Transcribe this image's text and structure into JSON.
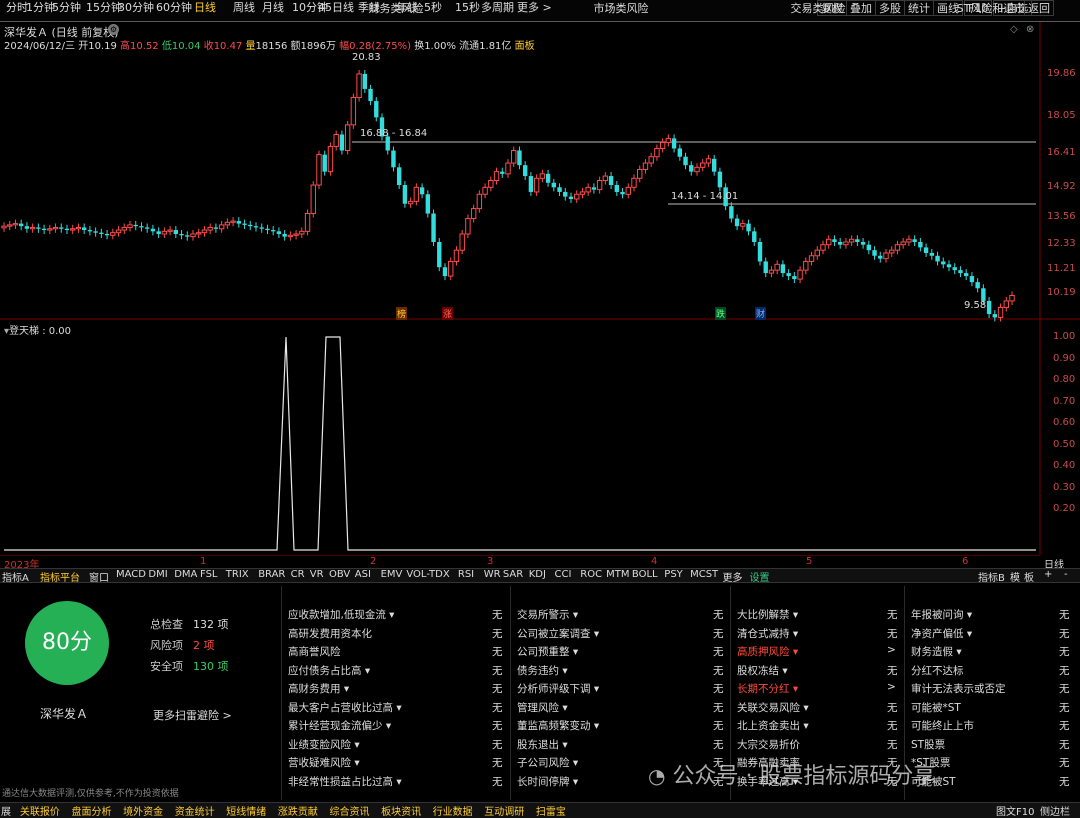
{
  "toolbar": {
    "periods": [
      "分时",
      "1分钟",
      "5分钟",
      "15分钟",
      "30分钟",
      "60分钟",
      "日线",
      "周线",
      "月线",
      "10分钟",
      "45日线",
      "季线",
      "年线",
      "5秒",
      "15秒",
      "多周期",
      "更多 >"
    ],
    "active_period": "日线",
    "right_buttons": [
      "复权",
      "叠加",
      "多股",
      "统计",
      "画线",
      "F10",
      "+自选",
      "返回"
    ]
  },
  "stock": {
    "title": "深华发Ａ (日线 前复权)",
    "date": "2024/06/12/三",
    "open_label": "开",
    "open": "10.19",
    "high_label": "高",
    "high": "10.52",
    "low_label": "低",
    "low": "10.04",
    "close_label": "收",
    "close": "10.47",
    "vol_label": "量",
    "vol": "18156",
    "amount_label": "额",
    "amount": "1896万",
    "change_label": "幅",
    "change": "0.28(2.75%)",
    "turnover_label": "换",
    "turnover": "1.00%",
    "float_label": "流通",
    "float": "1.81亿",
    "board": "面板"
  },
  "price_axis": [
    "19.86",
    "18.05",
    "16.41",
    "14.92",
    "13.56",
    "12.33",
    "11.21",
    "10.19"
  ],
  "annotations": {
    "peak": "20.83",
    "gap1": "16.88 - 16.84",
    "gap2": "14.14 - 14.01",
    "low": "9.58"
  },
  "event_badges": [
    "榜",
    "涨",
    "跌",
    "财"
  ],
  "indicator": {
    "title": "登天梯 : 0.00",
    "axis": [
      "1.00",
      "0.90",
      "0.80",
      "0.70",
      "0.60",
      "0.50",
      "0.40",
      "0.30",
      "0.20"
    ]
  },
  "x_axis": {
    "labels": [
      "2023年",
      "1",
      "2",
      "3",
      "4",
      "5",
      "6"
    ],
    "period": "日线"
  },
  "indicator_tabs": [
    "指标A",
    "指标平台",
    "窗口",
    "MACD",
    "DMI",
    "DMA",
    "FSL",
    "TRIX",
    "BRAR",
    "CR",
    "VR",
    "OBV",
    "ASI",
    "EMV",
    "VOL-TDX",
    "RSI",
    "WR",
    "SAR",
    "KDJ",
    "CCI",
    "ROC",
    "MTM",
    "BOLL",
    "PSY",
    "MCST",
    "更多",
    "设置"
  ],
  "indicator_tabs_right": [
    "指标B",
    "模",
    "板",
    "+",
    "-"
  ],
  "risk": {
    "score": "80分",
    "stock_name": "深华发Ａ",
    "total_label": "总检查",
    "total": "132 项",
    "risk_label": "风险项",
    "risk_count": "2 项",
    "safe_label": "安全项",
    "safe_count": "130 项",
    "more": "更多扫雷避险 >",
    "disclaimer": "通达信大数据评测,仅供参考,不作为投资依据",
    "columns": [
      {
        "title": "财务类风险",
        "items": [
          {
            "label": "应收款增加,低现金流 ▾",
            "value": "无"
          },
          {
            "label": "高研发费用资本化",
            "value": "无"
          },
          {
            "label": "高商誉风险",
            "value": "无"
          },
          {
            "label": "应付债务占比高 ▾",
            "value": "无"
          },
          {
            "label": "高财务费用 ▾",
            "value": "无"
          },
          {
            "label": "最大客户占营收比过高 ▾",
            "value": "无"
          },
          {
            "label": "累计经营现金流偏少 ▾",
            "value": "无"
          },
          {
            "label": "业绩变脸风险 ▾",
            "value": "无"
          },
          {
            "label": "营收疑难风险 ▾",
            "value": "无"
          },
          {
            "label": "非经常性损益占比过高 ▾",
            "value": "无"
          }
        ]
      },
      {
        "title": "市场类风险",
        "items": [
          {
            "label": "交易所警示 ▾",
            "value": "无"
          },
          {
            "label": "公司被立案调查 ▾",
            "value": "无"
          },
          {
            "label": "公司预重整 ▾",
            "value": "无"
          },
          {
            "label": "债务违约 ▾",
            "value": "无"
          },
          {
            "label": "分析师评级下调 ▾",
            "value": "无"
          },
          {
            "label": "管理风险 ▾",
            "value": "无"
          },
          {
            "label": "董监高频繁变动 ▾",
            "value": "无"
          },
          {
            "label": "股东退出 ▾",
            "value": "无"
          },
          {
            "label": "子公司风险 ▾",
            "value": "无"
          },
          {
            "label": "长时间停牌 ▾",
            "value": "无"
          }
        ]
      },
      {
        "title": "交易类风险",
        "items": [
          {
            "label": "大比例解禁 ▾",
            "value": "无"
          },
          {
            "label": "清仓式减持 ▾",
            "value": "无"
          },
          {
            "label": "高质押风险 ▾",
            "value": ">",
            "risk": true
          },
          {
            "label": "股权冻结 ▾",
            "value": "无"
          },
          {
            "label": "长期不分红 ▾",
            "value": ">",
            "risk": true
          },
          {
            "label": "关联交易风险 ▾",
            "value": "无"
          },
          {
            "label": "北上资金卖出 ▾",
            "value": "无"
          },
          {
            "label": "大宗交易折价",
            "value": "无"
          },
          {
            "label": "融券高融卖率",
            "value": "无"
          },
          {
            "label": "换手率过高 ▾",
            "value": "无"
          }
        ]
      },
      {
        "title": "ST风险和退市",
        "items": [
          {
            "label": "年报被问询 ▾",
            "value": "无"
          },
          {
            "label": "净资产偏低 ▾",
            "value": "无"
          },
          {
            "label": "财务造假 ▾",
            "value": "无"
          },
          {
            "label": "分红不达标",
            "value": "无"
          },
          {
            "label": "审计无法表示或否定",
            "value": "无"
          },
          {
            "label": "可能被*ST",
            "value": "无"
          },
          {
            "label": "可能终止上市",
            "value": "无"
          },
          {
            "label": "ST股票",
            "value": "无"
          },
          {
            "label": "*ST股票",
            "value": "无"
          },
          {
            "label": "可能被ST",
            "value": "无"
          }
        ]
      }
    ]
  },
  "status_tabs": [
    "展",
    "关联报价",
    "盘面分析",
    "境外资金",
    "资金统计",
    "短线情绪",
    "涨跌贡献",
    "综合资讯",
    "板块资讯",
    "行业数据",
    "互动调研",
    "扫雷宝"
  ],
  "status_right": [
    "图文F10",
    "侧边栏"
  ],
  "watermark": "公众号 · 股票指标源码分享",
  "colors": {
    "up": "#ff4b4b",
    "down": "#33dddd",
    "active": "#ffcc33",
    "score_bg": "#26b056",
    "risk_text": "#ff4b3a"
  }
}
